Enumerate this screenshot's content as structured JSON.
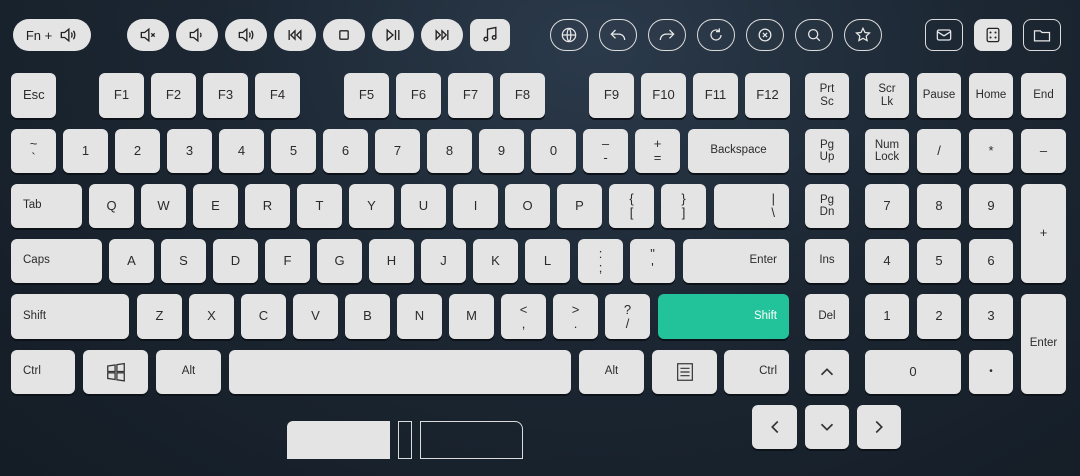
{
  "topbar": {
    "fn_label": "Fn +",
    "media": [
      {
        "name": "mute-button",
        "icon": "speaker-mute-icon"
      },
      {
        "name": "volume-down-button",
        "icon": "speaker-low-icon"
      },
      {
        "name": "volume-up-button",
        "icon": "speaker-high-icon"
      },
      {
        "name": "previous-track-button",
        "icon": "prev-track-icon"
      },
      {
        "name": "stop-button",
        "icon": "stop-icon"
      },
      {
        "name": "play-pause-button",
        "icon": "play-pause-icon"
      },
      {
        "name": "next-track-button",
        "icon": "next-track-icon"
      },
      {
        "name": "music-button",
        "icon": "music-note-icon"
      }
    ],
    "browser": [
      {
        "name": "web-home-button",
        "icon": "globe-icon"
      },
      {
        "name": "browser-back-button",
        "icon": "back-arrow-icon"
      },
      {
        "name": "browser-forward-button",
        "icon": "forward-arrow-icon"
      },
      {
        "name": "browser-refresh-button",
        "icon": "refresh-icon"
      },
      {
        "name": "browser-stop-button",
        "icon": "close-circle-icon"
      },
      {
        "name": "browser-search-button",
        "icon": "search-icon"
      },
      {
        "name": "browser-favorites-button",
        "icon": "star-icon"
      }
    ],
    "apps": [
      {
        "name": "mail-button",
        "icon": "mail-icon"
      },
      {
        "name": "calculator-button",
        "icon": "calculator-icon"
      },
      {
        "name": "explorer-button",
        "icon": "folder-icon"
      }
    ]
  },
  "keys": {
    "esc": "Esc",
    "f1": "F1",
    "f2": "F2",
    "f3": "F3",
    "f4": "F4",
    "f5": "F5",
    "f6": "F6",
    "f7": "F7",
    "f8": "F8",
    "f9": "F9",
    "f10": "F10",
    "f11": "F11",
    "f12": "F12",
    "prtsc": [
      "Prt",
      "Sc"
    ],
    "scrlk": [
      "Scr",
      "Lk"
    ],
    "pause": "Pause",
    "home": "Home",
    "end": "End",
    "tilde": [
      "~",
      "`"
    ],
    "d1": "1",
    "d2": "2",
    "d3": "3",
    "d4": "4",
    "d5": "5",
    "d6": "6",
    "d7": "7",
    "d8": "8",
    "d9": "9",
    "d0": "0",
    "minus": [
      "–",
      "-"
    ],
    "plus": [
      "+",
      "="
    ],
    "backspace": "Backspace",
    "pgup": [
      "Pg",
      "Up"
    ],
    "numlock": [
      "Num",
      "Lock"
    ],
    "np_div": "/",
    "np_mul": "*",
    "np_sub": "–",
    "tab": "Tab",
    "q": "Q",
    "w": "W",
    "e": "E",
    "r": "R",
    "t": "T",
    "y": "Y",
    "u": "U",
    "i": "I",
    "o": "O",
    "p": "P",
    "lbrace": [
      "{",
      "["
    ],
    "rbrace": [
      "}",
      "]"
    ],
    "pipe": [
      "|",
      "\\"
    ],
    "pgdn": [
      "Pg",
      "Dn"
    ],
    "np7": "7",
    "np8": "8",
    "np9": "9",
    "np_add": "+",
    "caps": "Caps",
    "a": "A",
    "s": "S",
    "d": "D",
    "f": "F",
    "g": "G",
    "h": "H",
    "j": "J",
    "k": "K",
    "l": "L",
    "semi": [
      ":",
      ";"
    ],
    "quote": [
      "\"",
      "'"
    ],
    "enter": "Enter",
    "ins": "Ins",
    "np4": "4",
    "np5": "5",
    "np6": "6",
    "shift_l": "Shift",
    "z": "Z",
    "x": "X",
    "c": "C",
    "v": "V",
    "b": "B",
    "n": "N",
    "m": "M",
    "comma": [
      "<",
      ","
    ],
    "period": [
      ">",
      "."
    ],
    "slash": [
      "?",
      "/"
    ],
    "shift_r": "Shift",
    "del": "Del",
    "np1": "1",
    "np2": "2",
    "np3": "3",
    "np_enter": "Enter",
    "ctrl_l": "Ctrl",
    "win_icon": "windows-icon",
    "alt_l": "Alt",
    "alt_r": "Alt",
    "menu_icon": "menu-icon",
    "ctrl_r": "Ctrl",
    "up_icon": "arrow-up-icon",
    "np0": "0",
    "np_dot": "•",
    "left_icon": "arrow-left-icon",
    "down_icon": "arrow-down-icon",
    "right_icon": "arrow-right-icon"
  },
  "colors": {
    "accent": "#22c39b",
    "key": "#e4e4e4",
    "background": "#1c2733"
  }
}
